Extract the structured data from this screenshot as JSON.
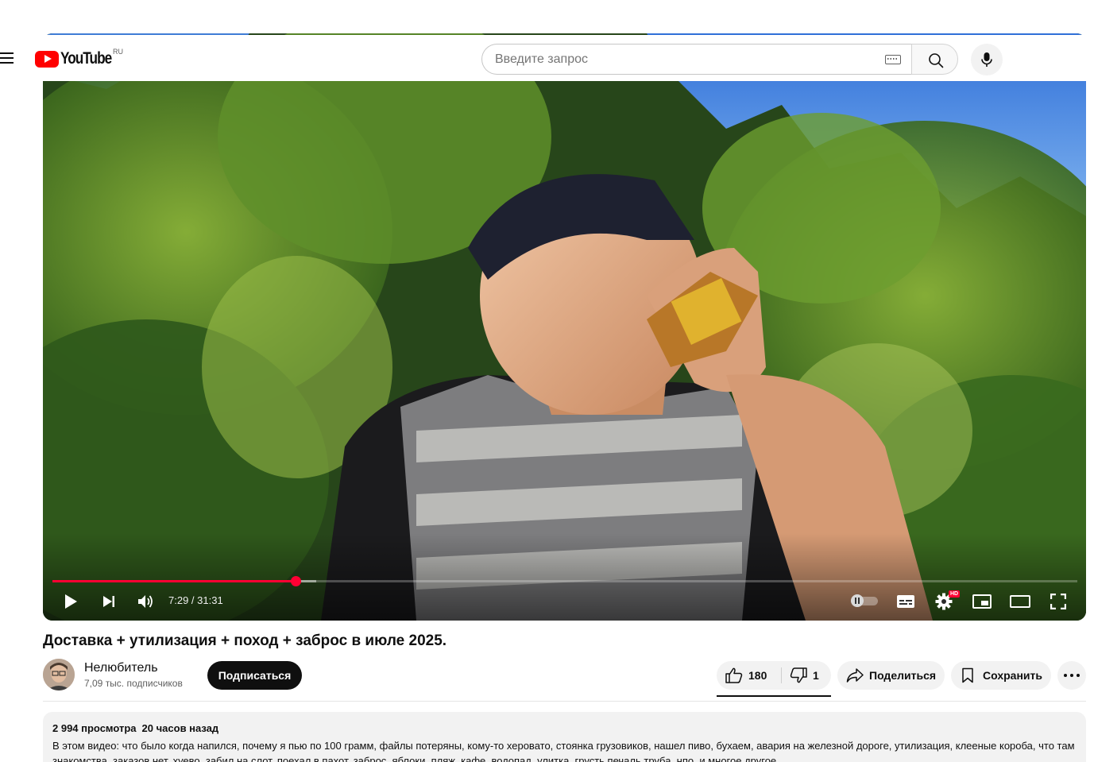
{
  "header": {
    "logo_text": "YouTube",
    "region": "RU",
    "search_placeholder": "Введите запрос"
  },
  "player": {
    "time_current": "7:29",
    "time_total": "31:31",
    "time_display": "7:29 / 31:31",
    "progress_fraction": 0.237,
    "buffered_fraction": 0.257,
    "hd_badge": "HD",
    "accent_color": "#ff0033"
  },
  "video": {
    "title": "Доставка + утилизация + поход + заброс в июле 2025."
  },
  "channel": {
    "name": "Нелюбитель",
    "subscribers": "7,09 тыс. подписчиков",
    "subscribe_label": "Подписаться"
  },
  "actions": {
    "likes": "180",
    "dislikes": "1",
    "share_label": "Поделиться",
    "save_label": "Сохранить"
  },
  "description": {
    "views": "2 994 просмотра",
    "posted": "20 часов назад",
    "text": "В этом видео: что было когда напился, почему я пью по 100 грамм, файлы потеряны, кому-то херовато, стоянка грузовиков, нашел пиво, бухаем, авария на железной дороге, утилизация, клееные короба, что там знакомства, заказов нет, хуево, забил на слот, поехал в пахот, заброс, яблоки, пляж, кафе, водопад, улитка, грусть печаль труба, нпо, и многое другое"
  }
}
